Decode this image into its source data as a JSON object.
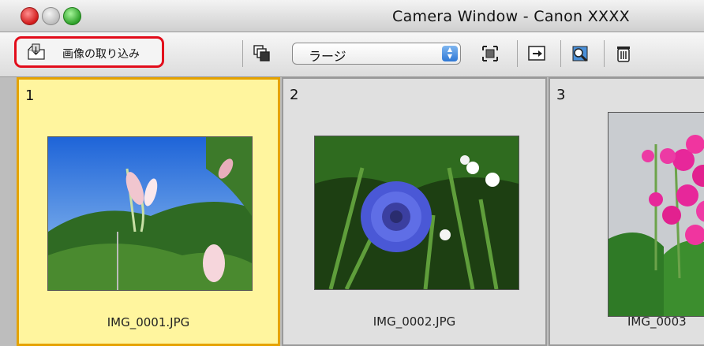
{
  "window": {
    "title": "Camera Window - Canon XXXX"
  },
  "toolbar": {
    "import_label": "画像の取り込み",
    "size_select": {
      "value": "ラージ"
    }
  },
  "thumbnails": [
    {
      "number": "1",
      "filename": "IMG_0001.JPG",
      "selected": true
    },
    {
      "number": "2",
      "filename": "IMG_0002.JPG",
      "selected": false
    },
    {
      "number": "3",
      "filename": "IMG_0003",
      "selected": false
    }
  ],
  "colors": {
    "selection_bg": "#fff59e",
    "selection_border": "#e5a200",
    "highlight": "#e20d1b"
  }
}
